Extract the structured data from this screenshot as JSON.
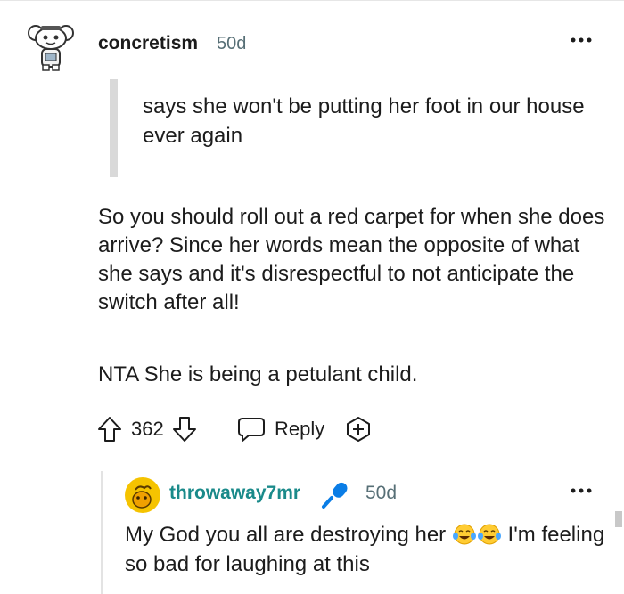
{
  "comment": {
    "username": "concretism",
    "timestamp": "50d",
    "quote": "says she won't be putting her foot in our house ever again",
    "paragraphs": [
      "So you should roll out a red carpet for when she does arrive? Since her words mean the opposite of what she says and it's disrespectful to not anticipate the switch after all!",
      "NTA She is being a petulant child."
    ],
    "vote_count": "362",
    "reply_label": "Reply",
    "avatar_icon": "snoo-avatar-icon"
  },
  "reply": {
    "username": "throwaway7mr",
    "username_color": "#1a8a8a",
    "timestamp": "50d",
    "text_before": "My God you all are destroying her",
    "emoji": "tears-of-joy-emoji",
    "text_after": "I'm feeling so bad for laughing at this",
    "badge_icon": "microphone-icon"
  },
  "colors": {
    "meta_text": "#576f76",
    "quote_bar": "#d9d9d9",
    "mic_blue": "#0a7de6"
  }
}
